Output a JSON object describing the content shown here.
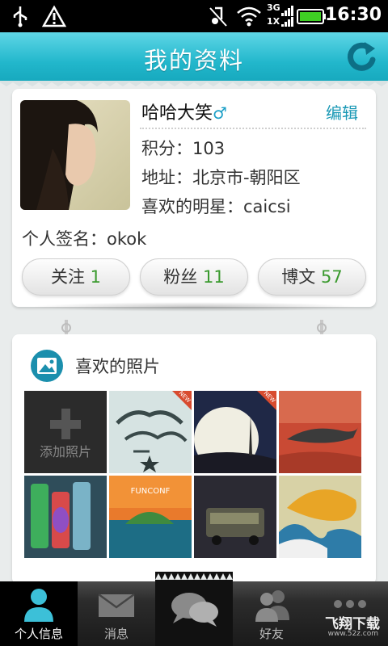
{
  "status_bar": {
    "time": "16:30",
    "network": "3G",
    "network2": "1X"
  },
  "header": {
    "title": "我的资料"
  },
  "profile": {
    "name": "哈哈大笑",
    "gender_symbol": "♂",
    "edit_label": "编辑",
    "points": "积分：103",
    "address": "地址：北京市-朝阳区",
    "favorite_star": "喜欢的明星：caicsi",
    "signature": "个人签名：okok",
    "stats": [
      {
        "label": "关注",
        "value": "1"
      },
      {
        "label": "粉丝",
        "value": "11"
      },
      {
        "label": "博文",
        "value": "57"
      }
    ]
  },
  "photos": {
    "title": "喜欢的照片",
    "add_label": "添加照片",
    "badge": "NEW"
  },
  "bottom_nav": {
    "items": [
      {
        "label": "个人信息"
      },
      {
        "label": "消息"
      },
      {
        "label": ""
      },
      {
        "label": "好友"
      },
      {
        "label": ""
      }
    ]
  },
  "watermark": {
    "text": "飞翔下载",
    "sub": "www.52z.com"
  },
  "colors": {
    "accent": "#22b7cc",
    "count_green": "#3a9a2e",
    "link": "#1998b5"
  }
}
